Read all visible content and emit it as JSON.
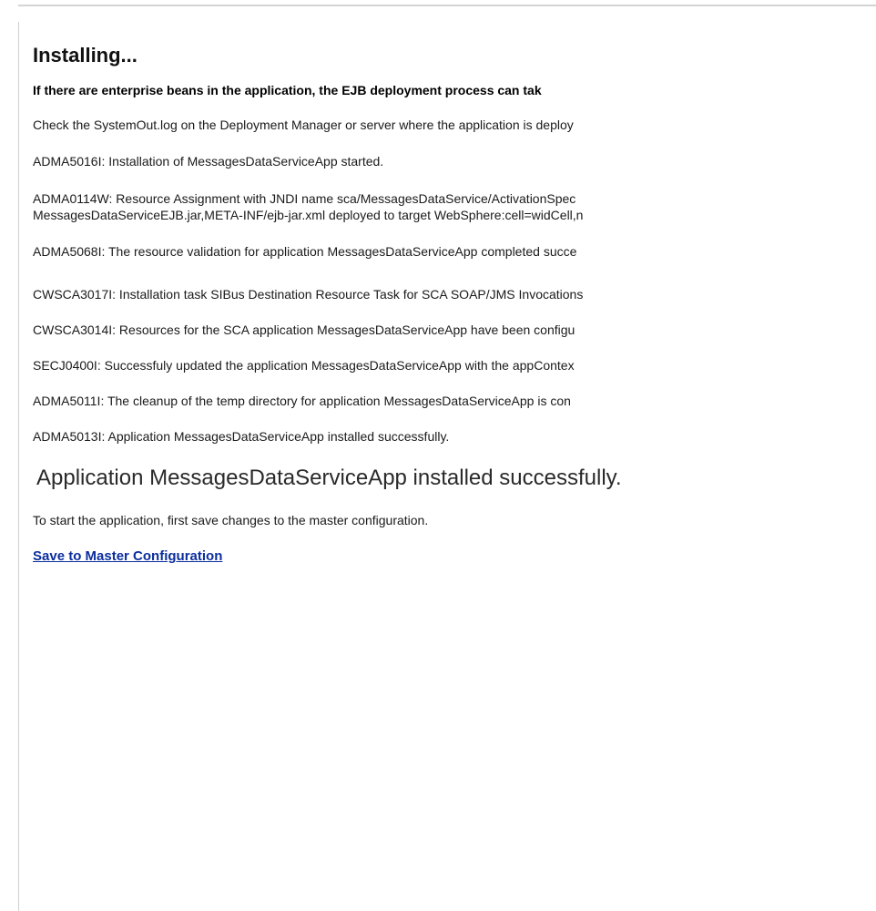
{
  "page": {
    "title": "Installing...",
    "warning": "If there are enterprise beans in the application, the EJB deployment process can tak",
    "check_log": "Check the SystemOut.log on the Deployment Manager or server where the application is deploy"
  },
  "messages": [
    "ADMA5016I: Installation of MessagesDataServiceApp started.",
    "ADMA0114W: Resource Assignment with JNDI name sca/MessagesDataService/ActivationSpec",
    "MessagesDataServiceEJB.jar,META-INF/ejb-jar.xml deployed to target WebSphere:cell=widCell,n",
    "ADMA5068I: The resource validation for application MessagesDataServiceApp completed succe",
    "CWSCA3017I: Installation task SIBus Destination Resource Task for SCA SOAP/JMS Invocations",
    "CWSCA3014I: Resources for the SCA application MessagesDataServiceApp have been configu",
    "SECJ0400I: Successfuly updated the application MessagesDataServiceApp with the appContex",
    "ADMA5011I: The cleanup of the temp directory for application MessagesDataServiceApp is con",
    "ADMA5013I: Application MessagesDataServiceApp installed successfully."
  ],
  "result": {
    "status": "Application MessagesDataServiceApp installed successfully.",
    "instruction": "To start the application, first save changes to the master configuration.",
    "save_link": "Save to Master Configuration",
    "link_color": "#0b2e9e"
  }
}
